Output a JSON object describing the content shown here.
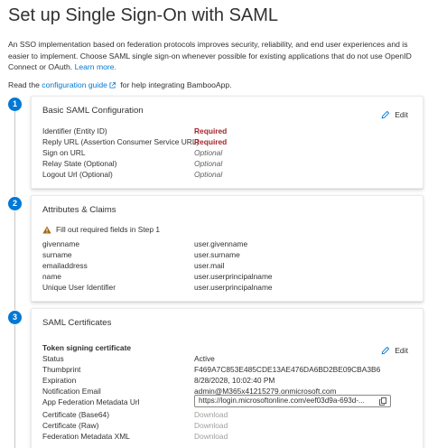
{
  "header": {
    "title": "Set up Single Sign-On with SAML",
    "intro": "An SSO implementation based on federation protocols improves security, reliability, and end user experiences and is easier to implement. Choose SAML single sign-on whenever possible for existing applications that do not use OpenID Connect or OAuth.",
    "learn_more": "Learn more.",
    "read_prefix": "Read the",
    "guide_link": "configuration guide",
    "read_suffix": "for help integrating BambooApp."
  },
  "accent_color": "#0078d4",
  "required_color": "#a4262c",
  "steps": [
    {
      "number": "1",
      "title": "Basic SAML Configuration",
      "edit_label": "Edit",
      "rows": [
        {
          "label": "Identifier (Entity ID)",
          "value": "Required"
        },
        {
          "label": "Reply URL (Assertion Consumer Service URL)",
          "value": "Required"
        },
        {
          "label": "Sign on URL",
          "value": "Optional"
        },
        {
          "label": "Relay State (Optional)",
          "value": "Optional"
        },
        {
          "label": "Logout Url (Optional)",
          "value": "Optional"
        }
      ]
    },
    {
      "number": "2",
      "title": "Attributes & Claims",
      "warning": "Fill out required fields in Step 1",
      "rows": [
        {
          "label": "givenname",
          "value": "user.givenname"
        },
        {
          "label": "surname",
          "value": "user.surname"
        },
        {
          "label": "emailaddress",
          "value": "user.mail"
        },
        {
          "label": "name",
          "value": "user.userprincipalname"
        },
        {
          "label": "Unique User Identifier",
          "value": "user.userprincipalname"
        }
      ]
    },
    {
      "number": "3",
      "title": "SAML Certificates",
      "subheading": "Token signing certificate",
      "edit_label": "Edit",
      "rows": [
        {
          "label": "Status",
          "value": "Active"
        },
        {
          "label": "Thumbprint",
          "value": "F469A7C853E485CDE13AE476DA6BD2BE09CBA3B6"
        },
        {
          "label": "Expiration",
          "value": "8/28/2028, 10:02:40 PM"
        },
        {
          "label": "Notification Email",
          "value": "admin@M365x41215279.onmicrosoft.com"
        },
        {
          "label": "App Federation Metadata Url",
          "value": "https://login.microsoftonline.com/eef03d9a-693d-..."
        },
        {
          "label": "Certificate (Base64)",
          "value": "Download"
        },
        {
          "label": "Certificate (Raw)",
          "value": "Download"
        },
        {
          "label": "Federation Metadata XML",
          "value": "Download"
        }
      ]
    }
  ],
  "icons": [
    "external-link-icon",
    "pencil-icon",
    "warning-icon",
    "copy-icon"
  ]
}
